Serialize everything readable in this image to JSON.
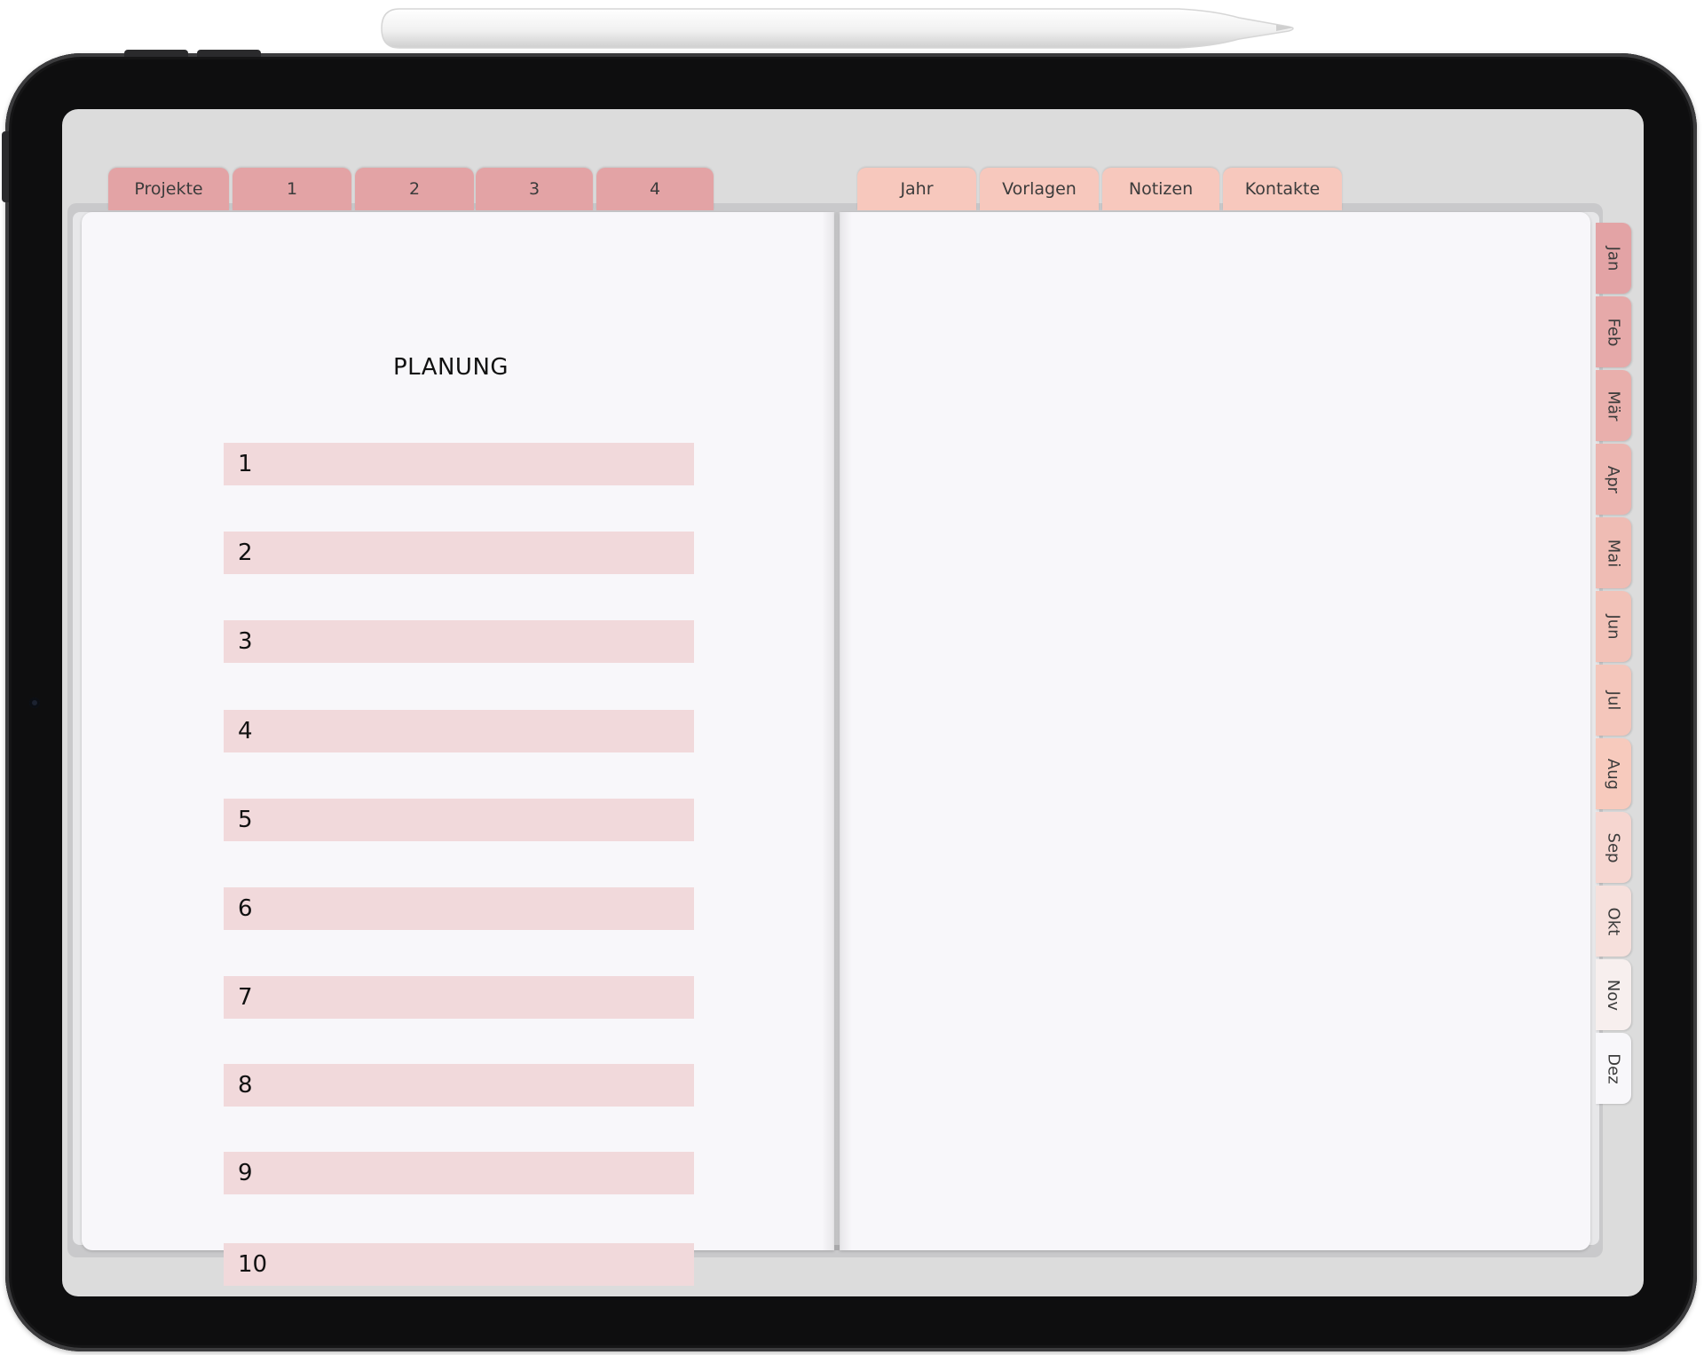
{
  "top_tabs_left": [
    {
      "label": "Projekte"
    },
    {
      "label": "1"
    },
    {
      "label": "2"
    },
    {
      "label": "3"
    },
    {
      "label": "4"
    }
  ],
  "top_tabs_right": [
    {
      "label": "Jahr"
    },
    {
      "label": "Vorlagen"
    },
    {
      "label": "Notizen"
    },
    {
      "label": "Kontakte"
    }
  ],
  "left_page": {
    "title": "PLANUNG",
    "rows": [
      "1",
      "2",
      "3",
      "4",
      "5",
      "6",
      "7",
      "8",
      "9",
      "10"
    ]
  },
  "month_tabs": [
    {
      "label": "Jan",
      "color": "#e3a3a5"
    },
    {
      "label": "Feb",
      "color": "#e6a9a9"
    },
    {
      "label": "Mär",
      "color": "#e9afac"
    },
    {
      "label": "Apr",
      "color": "#ecb5b0"
    },
    {
      "label": "Mai",
      "color": "#efbcb4"
    },
    {
      "label": "Jun",
      "color": "#f2c2b8"
    },
    {
      "label": "Jul",
      "color": "#f4c6bb"
    },
    {
      "label": "Aug",
      "color": "#f7cabd"
    },
    {
      "label": "Sep",
      "color": "#f6d6d0"
    },
    {
      "label": "Okt",
      "color": "#f6e0dc"
    },
    {
      "label": "Nov",
      "color": "#f7efee"
    },
    {
      "label": "Dez",
      "color": "#f8f7fa"
    }
  ],
  "colors": {
    "tab_dark": "#e3a3a5",
    "tab_light": "#f7c8bd",
    "row_bar": "#f1d9db",
    "page": "#f8f7fa"
  }
}
